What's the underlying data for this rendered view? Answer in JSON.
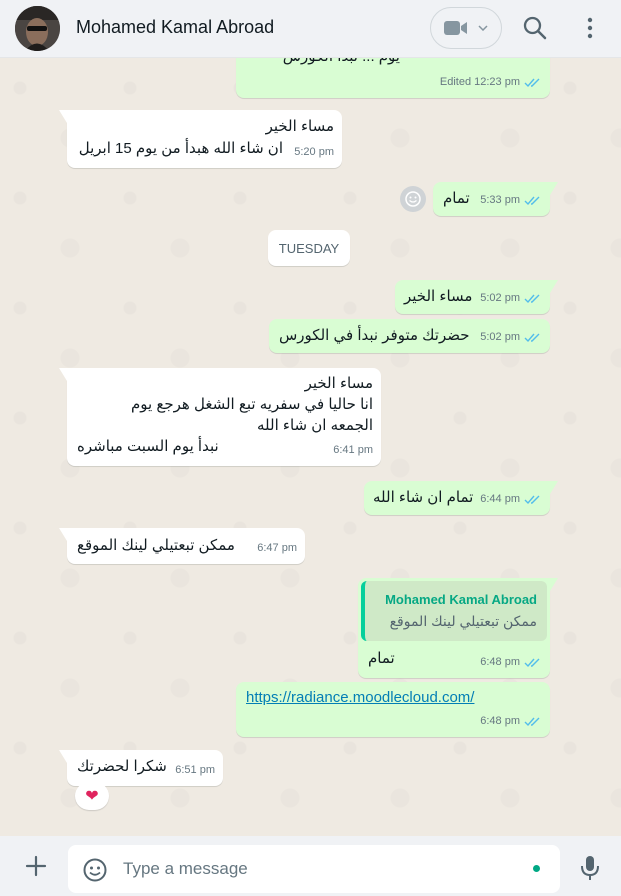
{
  "header": {
    "contact_name": "Mohamed Kamal Abroad",
    "icons": [
      "video-call-icon",
      "chevron-down-icon",
      "search-icon",
      "menu-icon"
    ]
  },
  "colors": {
    "incoming": "#ffffff",
    "outgoing": "#d9fdd3",
    "tick_read": "#53bdeb",
    "accent": "#00a884"
  },
  "messages": [
    {
      "direction": "out",
      "text": "",
      "meta": "Edited 12:23 pm",
      "status": "read"
    },
    {
      "direction": "in",
      "lines": [
        "مساء الخير",
        "ان شاء الله هبدأ من يوم 15 ابريل"
      ],
      "time": "5:20 pm"
    },
    {
      "direction": "out",
      "text": "تمام",
      "time": "5:33 pm",
      "status": "read"
    },
    {
      "direction": "out",
      "text": "مساء الخير",
      "time": "5:02 pm",
      "status": "read"
    },
    {
      "direction": "out",
      "text": "حضرتك متوفر نبدأ في الكورس",
      "time": "5:02 pm",
      "status": "read"
    },
    {
      "direction": "in",
      "lines": [
        "مساء الخير",
        "انا حاليا في سفريه تبع الشغل هرجع يوم",
        "الجمعه ان شاء الله",
        "نبدأ يوم السبت مباشره"
      ],
      "time": "6:41 pm"
    },
    {
      "direction": "out",
      "text": "تمام ان شاء الله",
      "time": "6:44 pm",
      "status": "read"
    },
    {
      "direction": "in",
      "text": "ممكن تبعتيلي لينك الموقع",
      "time": "6:47 pm"
    },
    {
      "direction": "out",
      "quote_author": "Mohamed Kamal Abroad",
      "quote_text": "ممكن تبعتيلي لينك الموقع",
      "text": "تمام",
      "time": "6:48 pm",
      "status": "read"
    },
    {
      "direction": "out",
      "link": "https://radiance.moodlecloud.com/",
      "time": "6:48 pm",
      "status": "read"
    },
    {
      "direction": "in",
      "text": "شكرا لحضرتك",
      "time": "6:51 pm",
      "reaction": "❤"
    }
  ],
  "date_divider": "TUESDAY",
  "composer": {
    "placeholder": "Type a message"
  }
}
